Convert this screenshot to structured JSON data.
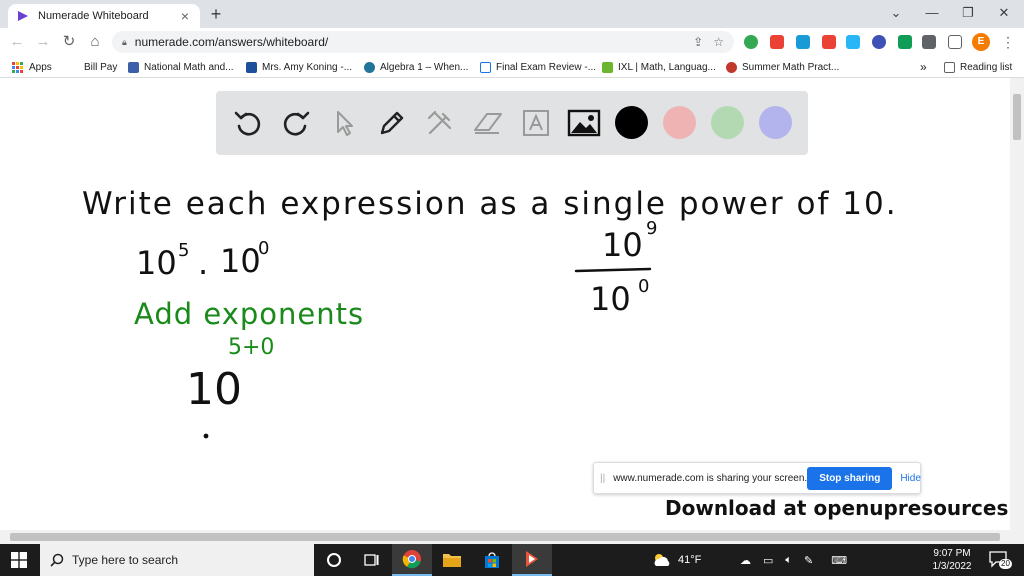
{
  "browser": {
    "tab": {
      "title": "Numerade Whiteboard"
    },
    "url": "numerade.com/answers/whiteboard/",
    "profile_initial": "E",
    "bookmarks": [
      {
        "label": "Apps"
      },
      {
        "label": "Bill Pay"
      },
      {
        "label": "National Math and..."
      },
      {
        "label": "Mrs. Amy Koning -..."
      },
      {
        "label": "Algebra 1 – When..."
      },
      {
        "label": "Final Exam Review -..."
      },
      {
        "label": "IXL | Math, Languag..."
      },
      {
        "label": "Summer Math Pract..."
      }
    ],
    "more_bookmarks": "»",
    "reading_list": "Reading list"
  },
  "whiteboard": {
    "tools": [
      "undo-icon",
      "redo-icon",
      "pointer-icon",
      "pen-icon",
      "tools-icon",
      "eraser-icon",
      "text-icon",
      "image-icon"
    ],
    "colors": [
      "#000000",
      "#f0b3b3",
      "#b3d9b3",
      "#b3b3ee"
    ],
    "notes": {
      "instruction": "Write each expression as a single power of 10.",
      "expr1_base": "10",
      "expr1_exp": "5",
      "expr1_dot": ".",
      "expr1_base2": "10",
      "expr1_exp2": "0",
      "step": "Add exponents",
      "result_base": "10",
      "result_exp": "5+0",
      "frac_num_base": "10",
      "frac_num_exp": "9",
      "frac_den_base": "10",
      "frac_den_exp": "0"
    },
    "ink_colors": {
      "black": "#111111",
      "green": "#1a8a1a"
    }
  },
  "share_bar": {
    "message": "www.numerade.com is sharing your screen.",
    "stop_label": "Stop sharing",
    "hide_label": "Hide"
  },
  "watermark": "Download at openupresources.org",
  "taskbar": {
    "search_placeholder": "Type here to search",
    "weather": "41°F",
    "time": "9:07 PM",
    "date": "1/3/2022",
    "notifications": "20"
  }
}
